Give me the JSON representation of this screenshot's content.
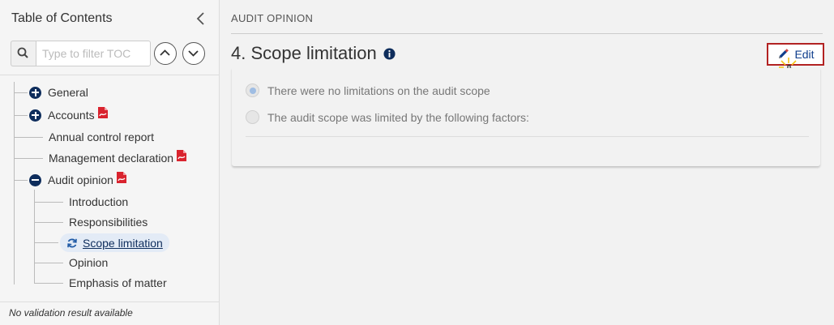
{
  "sidebar": {
    "title": "Table of Contents",
    "filter_placeholder": "Type to filter TOC",
    "items": [
      {
        "label": "General"
      },
      {
        "label": "Accounts"
      },
      {
        "label": "Annual control report"
      },
      {
        "label": "Management declaration"
      },
      {
        "label": "Audit opinion"
      },
      {
        "label": "Introduction"
      },
      {
        "label": "Responsibilities"
      },
      {
        "label": "Scope limitation"
      },
      {
        "label": "Opinion"
      },
      {
        "label": "Emphasis of matter"
      }
    ],
    "footer": "No validation result available"
  },
  "main": {
    "breadcrumb": "AUDIT OPINION",
    "title": "4. Scope limitation",
    "edit_label": "Edit",
    "options": [
      {
        "label": "There were no limitations on the audit scope",
        "checked": true
      },
      {
        "label": "The audit scope was limited by the following factors:",
        "checked": false
      }
    ]
  },
  "colors": {
    "accent": "#0e2d5c",
    "highlight_border": "#b22222",
    "pdf_red": "#d9232e"
  }
}
